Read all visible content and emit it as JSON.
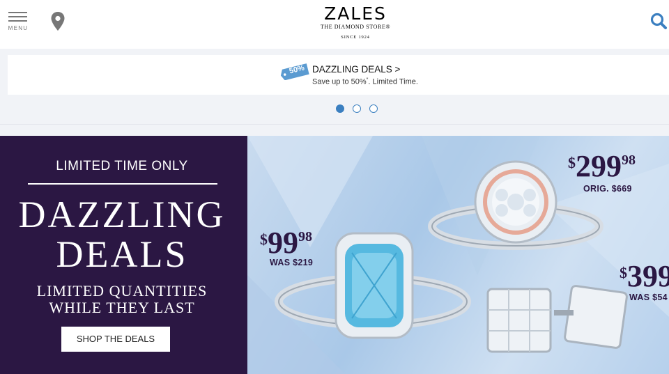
{
  "header": {
    "menu_label": "MENU",
    "logo_main": "ZALES",
    "logo_sub": "THE DIAMOND STORE®",
    "logo_since": "SINCE 1924",
    "icons": [
      "menu-icon",
      "location-pin-icon",
      "search-icon"
    ]
  },
  "promo": {
    "tag_text": "50%",
    "title": "DAZZLING DEALS >",
    "subtitle_before": "Save up to 50%",
    "subtitle_sup": "*",
    "subtitle_after": ". Limited Time."
  },
  "carousel": {
    "total_slides": 3,
    "active_slide": 1
  },
  "banner": {
    "limited": "LIMITED TIME ONLY",
    "headline1": "DAZZLING",
    "headline2": "DEALS",
    "quantities1": "LIMITED QUANTITIES",
    "quantities2": "WHILE THEY LAST",
    "cta": "SHOP THE DEALS"
  },
  "prices": {
    "ring1": {
      "currency": "$",
      "amount": "99",
      "cents": "98",
      "was": "WAS $219"
    },
    "ring2": {
      "currency": "$",
      "amount": "299",
      "cents": "98",
      "was": "ORIG. $669"
    },
    "earrings": {
      "currency": "$",
      "amount": "399",
      "cents": "",
      "was": "WAS $54"
    }
  },
  "colors": {
    "brand_purple": "#2b1743",
    "accent_blue": "#3b7fc0",
    "tag_blue": "#5b9bd1"
  }
}
